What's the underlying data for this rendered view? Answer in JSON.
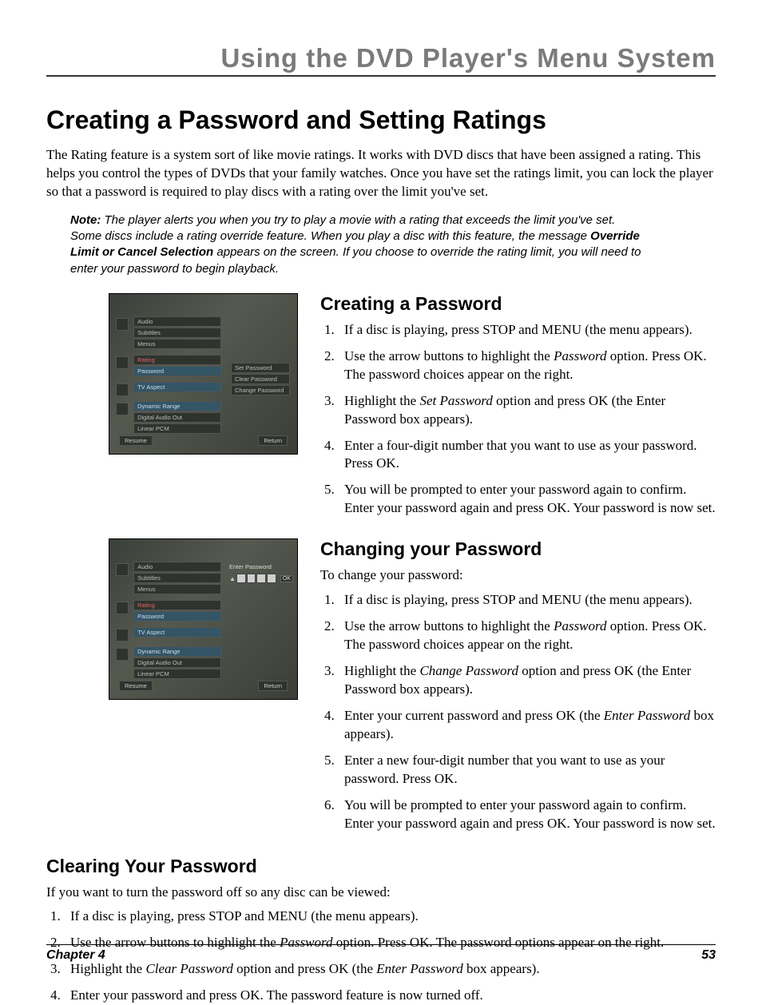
{
  "header": "Using the DVD Player's Menu System",
  "h1": "Creating a Password and Setting Ratings",
  "intro": "The Rating feature is a system sort of like movie ratings. It works with DVD discs that have been assigned a rating. This helps you control the types of DVDs that your family watches. Once you have set the ratings limit, you can lock the player so that a password is required to play discs with a rating over the limit you've set.",
  "note": {
    "label": "Note:",
    "t1": " The player alerts you when you try to play a movie with a rating that exceeds the limit you've set. Some discs include a rating override feature. When you play a disc with this feature, the message ",
    "bold": "Override Limit or Cancel Selection",
    "t2": " appears on the screen. If you choose to override the rating limit, you will need to enter your password to begin playback."
  },
  "shot_menu": {
    "g1": [
      "Audio",
      "Subtitles",
      "Menus"
    ],
    "g2": [
      "Rating",
      "Password"
    ],
    "g3": [
      "TV Aspect"
    ],
    "g4": [
      "Dynamic Range",
      "Digital Audio Out",
      "Linear PCM"
    ],
    "sub": [
      "Set Password",
      "Clear Password",
      "Change Password"
    ],
    "enter": "Enter Password",
    "ok": "OK",
    "resume": "Resume",
    "ret": "Return"
  },
  "sec1": {
    "h": "Creating a Password",
    "steps": [
      {
        "pre": "If a disc is playing, press STOP and MENU (the menu appears)."
      },
      {
        "pre": "Use the arrow buttons to highlight the ",
        "it": "Password",
        "post": " option. Press OK. The password choices appear on the right."
      },
      {
        "pre": "Highlight the ",
        "it": "Set Password",
        "post": " option and press OK (the Enter Password box appears)."
      },
      {
        "pre": "Enter a four-digit number that you want to use as your password. Press OK."
      },
      {
        "pre": "You will be prompted to enter your password again to confirm. Enter your password again and press OK. Your password is now set."
      }
    ]
  },
  "sec2": {
    "h": "Changing your Password",
    "lead": "To change your password:",
    "steps": [
      {
        "pre": "If a disc is playing, press STOP and MENU (the menu appears)."
      },
      {
        "pre": "Use the arrow buttons to highlight the ",
        "it": "Password",
        "post": " option. Press OK. The password choices appear on the right."
      },
      {
        "pre": "Highlight the ",
        "it": "Change Password",
        "post": " option and press OK (the Enter Password box appears)."
      },
      {
        "pre": "Enter your current password and press OK (the ",
        "it": "Enter Password",
        "post": " box appears)."
      },
      {
        "pre": "Enter a new four-digit number that you want to use as your password. Press OK."
      },
      {
        "pre": "You will be prompted to enter your password again to confirm. Enter your password again and press OK. Your password is now set."
      }
    ]
  },
  "sec3": {
    "h": "Clearing Your Password",
    "lead": "If you want to turn the password off so any disc can be viewed:",
    "steps": [
      {
        "pre": "If a disc is playing, press STOP and MENU (the menu appears)."
      },
      {
        "pre": "Use the arrow buttons to highlight the ",
        "it": "Password",
        "post": " option. Press OK. The password options appear on the right."
      },
      {
        "pre": "Highlight the ",
        "it": "Clear Password",
        "post": " option and press OK (the ",
        "it2": "Enter Password",
        "post2": " box appears)."
      },
      {
        "pre": "Enter your password and press OK. The password feature is now turned off."
      }
    ]
  },
  "footer": {
    "chapter": "Chapter 4",
    "page": "53"
  }
}
